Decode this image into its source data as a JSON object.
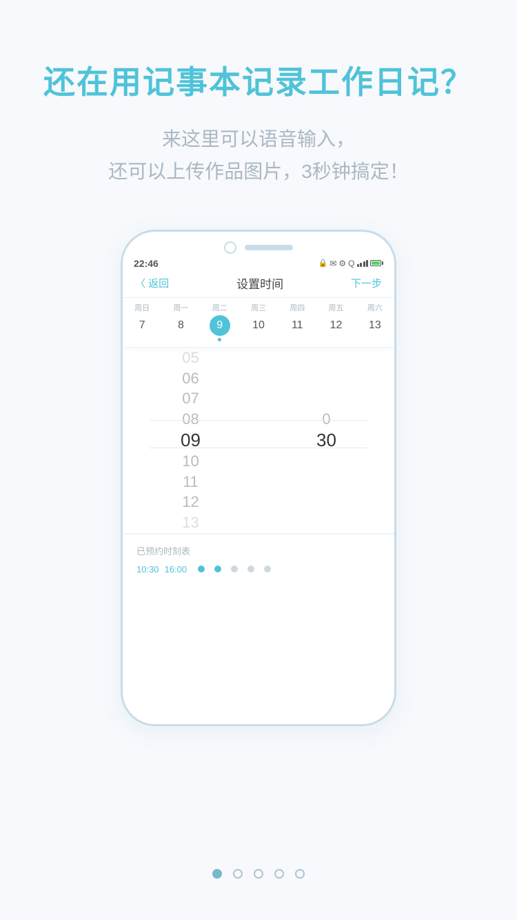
{
  "header": {
    "main_title": "还在用记事本记录工作日记？",
    "sub_title_line1": "来这里可以语音输入，",
    "sub_title_line2": "还可以上传作品图片，3秒钟搞定！"
  },
  "phone": {
    "status": {
      "time": "22:46",
      "icons_text": "🔒 ✉ ⚙ Q"
    },
    "nav": {
      "back": "〈 返回",
      "title": "设置时间",
      "next": "下一步"
    },
    "week": {
      "days": [
        {
          "name": "周日",
          "num": "7",
          "active": false,
          "dot": false
        },
        {
          "name": "周一",
          "num": "8",
          "active": false,
          "dot": false
        },
        {
          "name": "周二",
          "num": "9",
          "active": true,
          "dot": true
        },
        {
          "name": "周三",
          "num": "10",
          "active": false,
          "dot": false
        },
        {
          "name": "周四",
          "num": "11",
          "active": false,
          "dot": false
        },
        {
          "name": "周五",
          "num": "12",
          "active": false,
          "dot": false
        },
        {
          "name": "周六",
          "num": "13",
          "active": false,
          "dot": false
        }
      ]
    },
    "time_picker": {
      "hours": [
        "05",
        "06",
        "07",
        "08",
        "09",
        "10",
        "11",
        "12",
        "13"
      ],
      "selected_hour": "09",
      "minutes": [
        "",
        "",
        "",
        "0",
        "30",
        "",
        "",
        "",
        ""
      ],
      "selected_minute": "30"
    },
    "schedule": {
      "label": "已预约时刻表",
      "times": [
        {
          "value": "10:30",
          "active": true
        },
        {
          "value": "16:00",
          "active": true
        },
        {
          "active": false
        },
        {
          "active": false
        },
        {
          "active": false
        }
      ]
    }
  },
  "pagination": {
    "total": 5,
    "active_index": 0,
    "dots": [
      "active",
      "inactive",
      "inactive",
      "inactive",
      "inactive"
    ]
  }
}
